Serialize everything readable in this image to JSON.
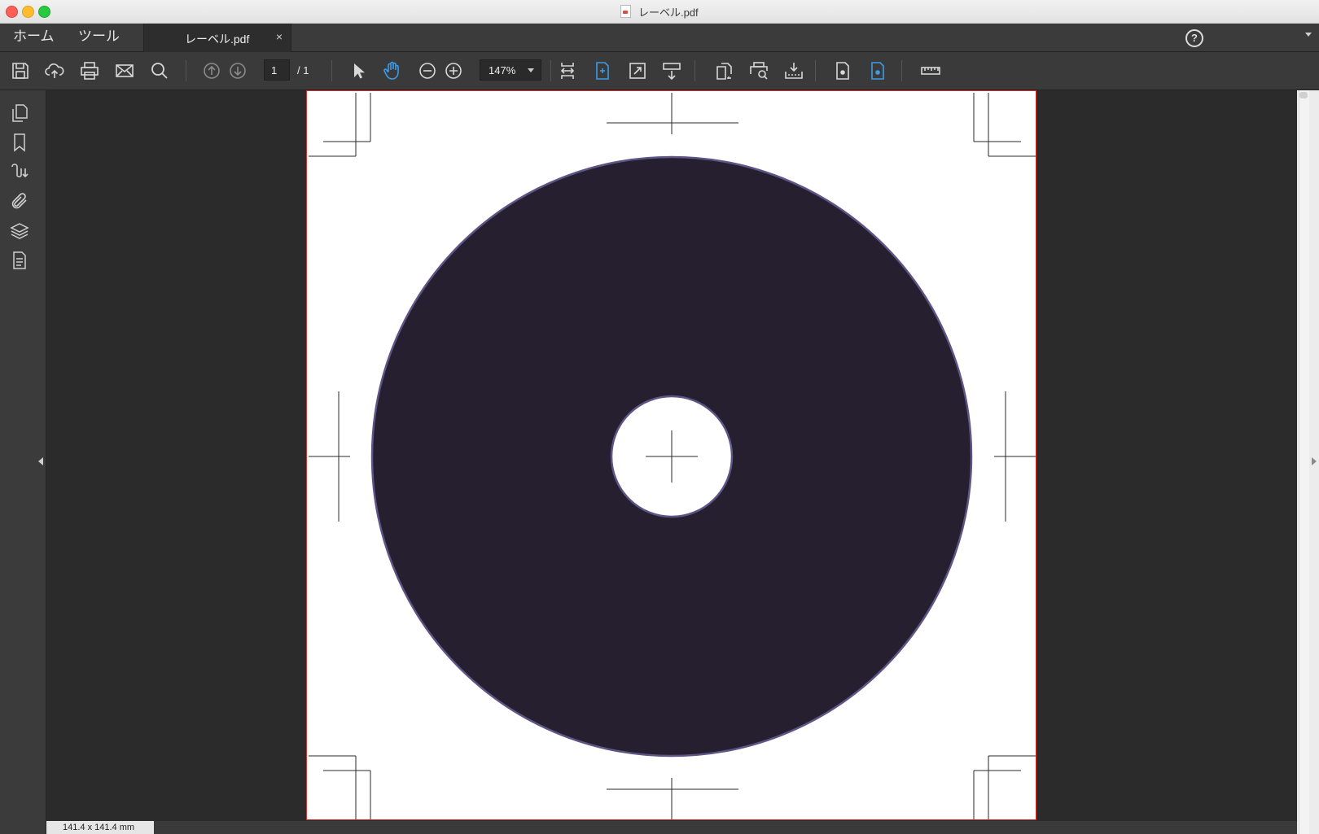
{
  "window": {
    "title": "レーベル.pdf"
  },
  "tabs": {
    "home": "ホーム",
    "tools": "ツール",
    "document": "レーベル.pdf",
    "close_glyph": "×",
    "help_glyph": "?"
  },
  "toolbar": {
    "page_current": "1",
    "page_total": "/ 1",
    "zoom": "147%",
    "icons": [
      "save-icon",
      "cloud-upload-icon",
      "print-icon",
      "email-icon",
      "search-icon",
      "page-up-icon",
      "page-down-icon",
      "select-arrow-icon",
      "hand-icon",
      "zoom-out-icon",
      "zoom-in-icon",
      "fit-width-icon",
      "fit-page-icon",
      "fullscreen-icon",
      "scroll-mode-icon",
      "rotate-icon",
      "print-preview-icon",
      "export-icon",
      "single-page-icon",
      "continuous-page-icon",
      "ruler-icon"
    ],
    "active_color": "#3d9be9"
  },
  "sidebar": {
    "icons": [
      "pages-icon",
      "bookmark-icon",
      "signature-icon",
      "attachment-icon",
      "layers-icon",
      "document-properties-icon"
    ]
  },
  "document": {
    "disc_color": "#251f2f",
    "disc_outline": "#5e5585",
    "page_border_color": "#d6312e"
  },
  "status": {
    "page_size": "141.4 x 141.4 mm"
  }
}
